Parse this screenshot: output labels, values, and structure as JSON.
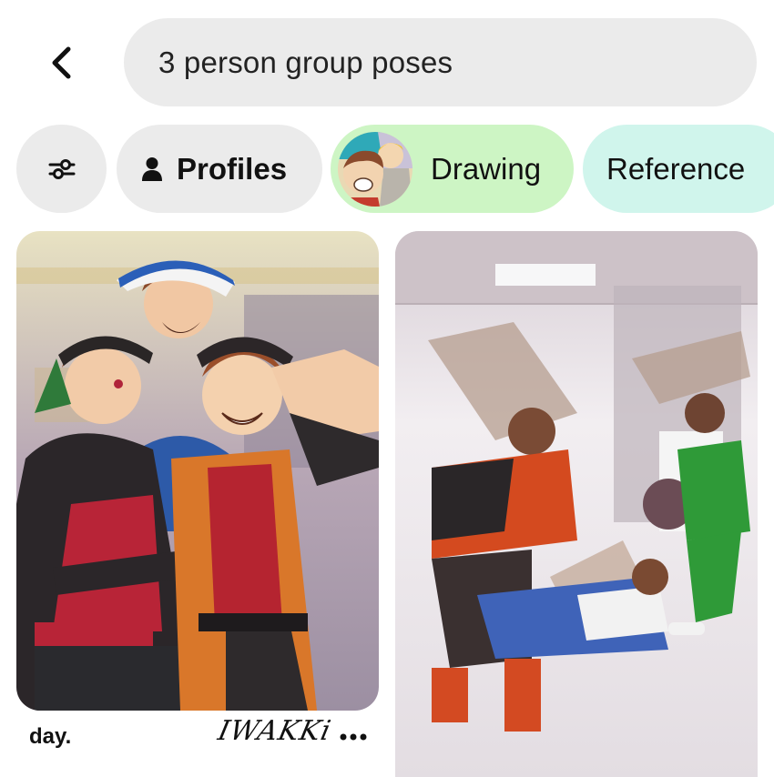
{
  "search": {
    "query": "3 person group poses"
  },
  "filters": {
    "filter_icon": "sliders-icon",
    "profiles_label": "Profiles",
    "drawing_label": "Drawing",
    "reference_label": "Reference"
  },
  "pins": [
    {
      "title": "day.",
      "signature": "IWAKKi",
      "more_icon": "more-dots-icon"
    },
    {
      "title": ""
    }
  ],
  "colors": {
    "chip_gray": "#ebebeb",
    "drawing_chip": "#cdf5c4",
    "reference_chip": "#d0f5ec"
  }
}
